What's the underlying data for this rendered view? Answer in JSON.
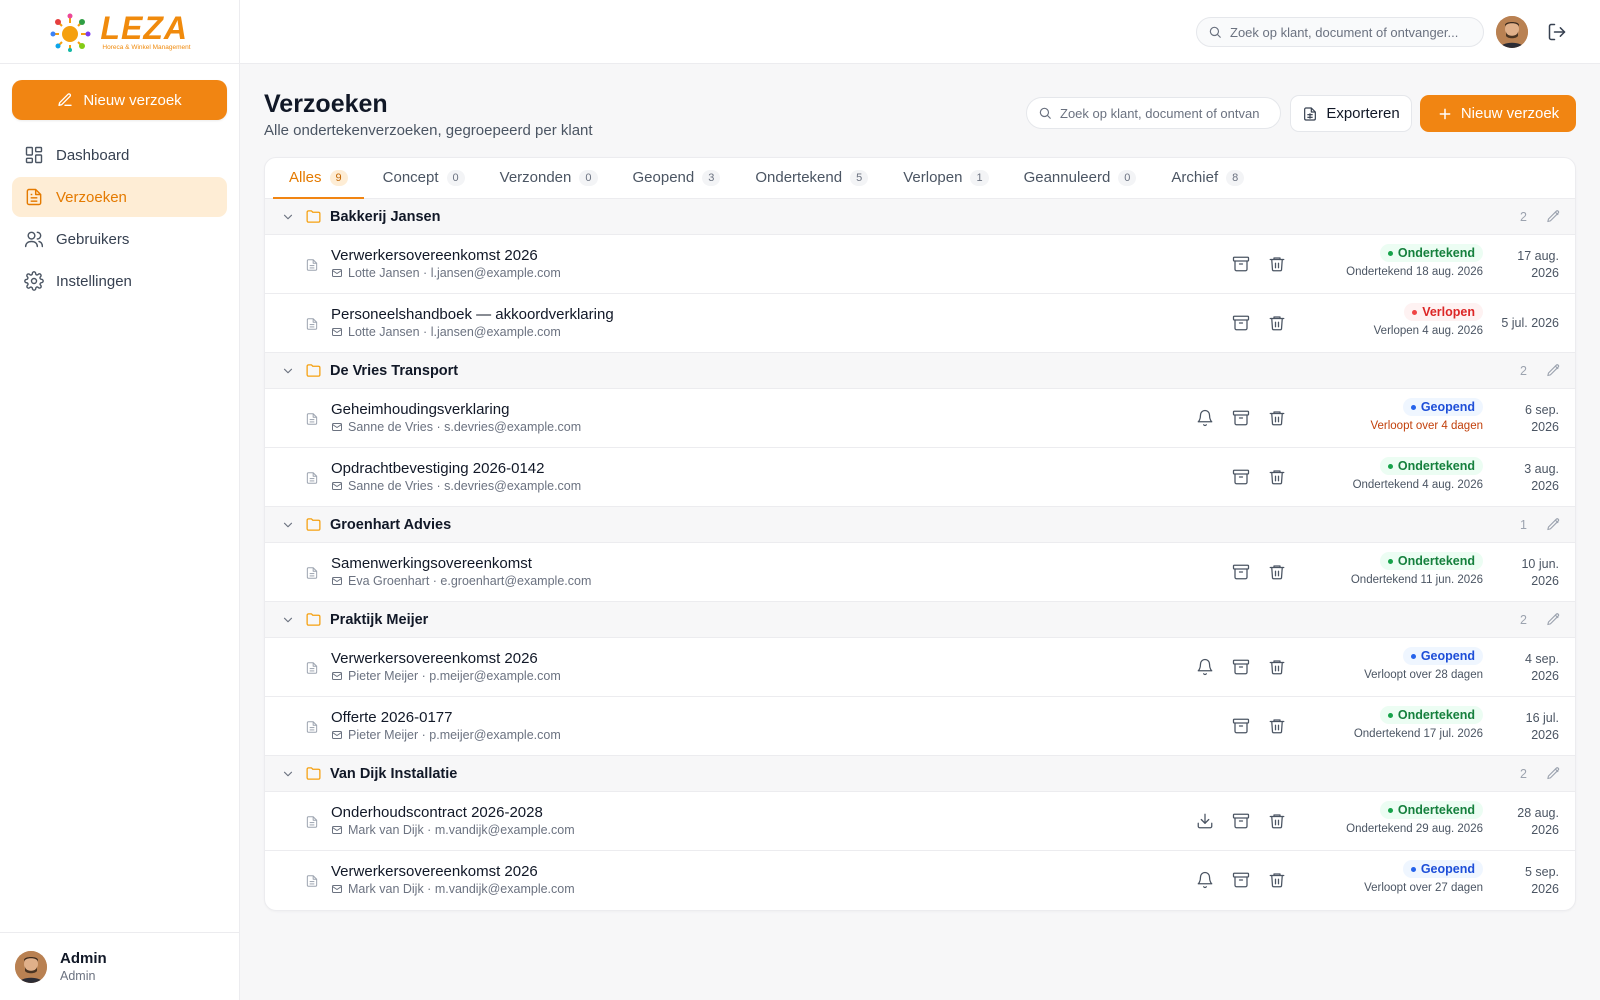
{
  "app": {
    "logo_word": "LEZA",
    "logo_tagline": "Horeca & Winkel Management",
    "new_request_label": "Nieuw verzoek"
  },
  "nav": [
    {
      "label": "Dashboard",
      "icon": "dashboard-icon"
    },
    {
      "label": "Verzoeken",
      "icon": "document-icon",
      "active": true
    },
    {
      "label": "Gebruikers",
      "icon": "users-icon"
    },
    {
      "label": "Instellingen",
      "icon": "gear-icon"
    }
  ],
  "user": {
    "name": "Admin",
    "role": "Admin"
  },
  "topbar": {
    "search_placeholder": "Zoek op klant, document of ontvanger..."
  },
  "page": {
    "title": "Verzoeken",
    "subtitle": "Alle ondertekenverzoeken, gegroepeerd per klant",
    "search_placeholder": "Zoek op klant, document of ontvanger...",
    "export_label": "Exporteren",
    "new_label": "Nieuw verzoek"
  },
  "tabs": [
    {
      "label": "Alles",
      "count": "9",
      "active": true
    },
    {
      "label": "Concept",
      "count": "0"
    },
    {
      "label": "Verzonden",
      "count": "0"
    },
    {
      "label": "Geopend",
      "count": "3"
    },
    {
      "label": "Ondertekend",
      "count": "5"
    },
    {
      "label": "Verlopen",
      "count": "1"
    },
    {
      "label": "Geannuleerd",
      "count": "0"
    },
    {
      "label": "Archief",
      "count": "8"
    }
  ],
  "groups": [
    {
      "name": "Bakkerij Jansen",
      "count": "2",
      "rows": [
        {
          "title": "Verwerkersovereenkomst 2026",
          "meta": "Lotte Jansen · l.jansen@example.com",
          "status": "Ondertekend",
          "status_color": "green",
          "status_sub": "Ondertekend 18 aug. 2026",
          "date_line1": "17 aug.",
          "date_line2": "2026",
          "bell": false,
          "download": false
        },
        {
          "title": "Personeelshandboek — akkoordverklaring",
          "meta": "Lotte Jansen · l.jansen@example.com",
          "status": "Verlopen",
          "status_color": "red",
          "status_sub": "Verlopen 4 aug. 2026",
          "date_line1": "5 jul. 2026",
          "date_line2": "",
          "bell": false,
          "download": false
        }
      ]
    },
    {
      "name": "De Vries Transport",
      "count": "2",
      "rows": [
        {
          "title": "Geheimhoudingsverklaring",
          "meta": "Sanne de Vries · s.devries@example.com",
          "status": "Geopend",
          "status_color": "blue",
          "status_sub": "Verloopt over 4 dagen",
          "status_sub_warn": true,
          "date_line1": "6 sep.",
          "date_line2": "2026",
          "bell": true,
          "download": false
        },
        {
          "title": "Opdrachtbevestiging 2026-0142",
          "meta": "Sanne de Vries · s.devries@example.com",
          "status": "Ondertekend",
          "status_color": "green",
          "status_sub": "Ondertekend 4 aug. 2026",
          "date_line1": "3 aug.",
          "date_line2": "2026",
          "bell": false,
          "download": false
        }
      ]
    },
    {
      "name": "Groenhart Advies",
      "count": "1",
      "rows": [
        {
          "title": "Samenwerkingsovereenkomst",
          "meta": "Eva Groenhart · e.groenhart@example.com",
          "status": "Ondertekend",
          "status_color": "green",
          "status_sub": "Ondertekend 11 jun. 2026",
          "date_line1": "10 jun.",
          "date_line2": "2026",
          "bell": false,
          "download": false
        }
      ]
    },
    {
      "name": "Praktijk Meijer",
      "count": "2",
      "rows": [
        {
          "title": "Verwerkersovereenkomst 2026",
          "meta": "Pieter Meijer · p.meijer@example.com",
          "status": "Geopend",
          "status_color": "blue",
          "status_sub": "Verloopt over 28 dagen",
          "date_line1": "4 sep.",
          "date_line2": "2026",
          "bell": true,
          "download": false
        },
        {
          "title": "Offerte 2026-0177",
          "meta": "Pieter Meijer · p.meijer@example.com",
          "status": "Ondertekend",
          "status_color": "green",
          "status_sub": "Ondertekend 17 jul. 2026",
          "date_line1": "16 jul.",
          "date_line2": "2026",
          "bell": false,
          "download": false
        }
      ]
    },
    {
      "name": "Van Dijk Installatie",
      "count": "2",
      "rows": [
        {
          "title": "Onderhoudscontract 2026-2028",
          "meta": "Mark van Dijk · m.vandijk@example.com",
          "status": "Ondertekend",
          "status_color": "green",
          "status_sub": "Ondertekend 29 aug. 2026",
          "date_line1": "28 aug.",
          "date_line2": "2026",
          "bell": false,
          "download": true
        },
        {
          "title": "Verwerkersovereenkomst 2026",
          "meta": "Mark van Dijk · m.vandijk@example.com",
          "status": "Geopend",
          "status_color": "blue",
          "status_sub": "Verloopt over 27 dagen",
          "date_line1": "5 sep.",
          "date_line2": "2026",
          "bell": true,
          "download": false
        }
      ]
    }
  ],
  "colors": {
    "accent": "#f18512",
    "accent_soft": "#feedd5",
    "green": "#16a34a",
    "red": "#ef4444",
    "blue": "#2563eb"
  }
}
